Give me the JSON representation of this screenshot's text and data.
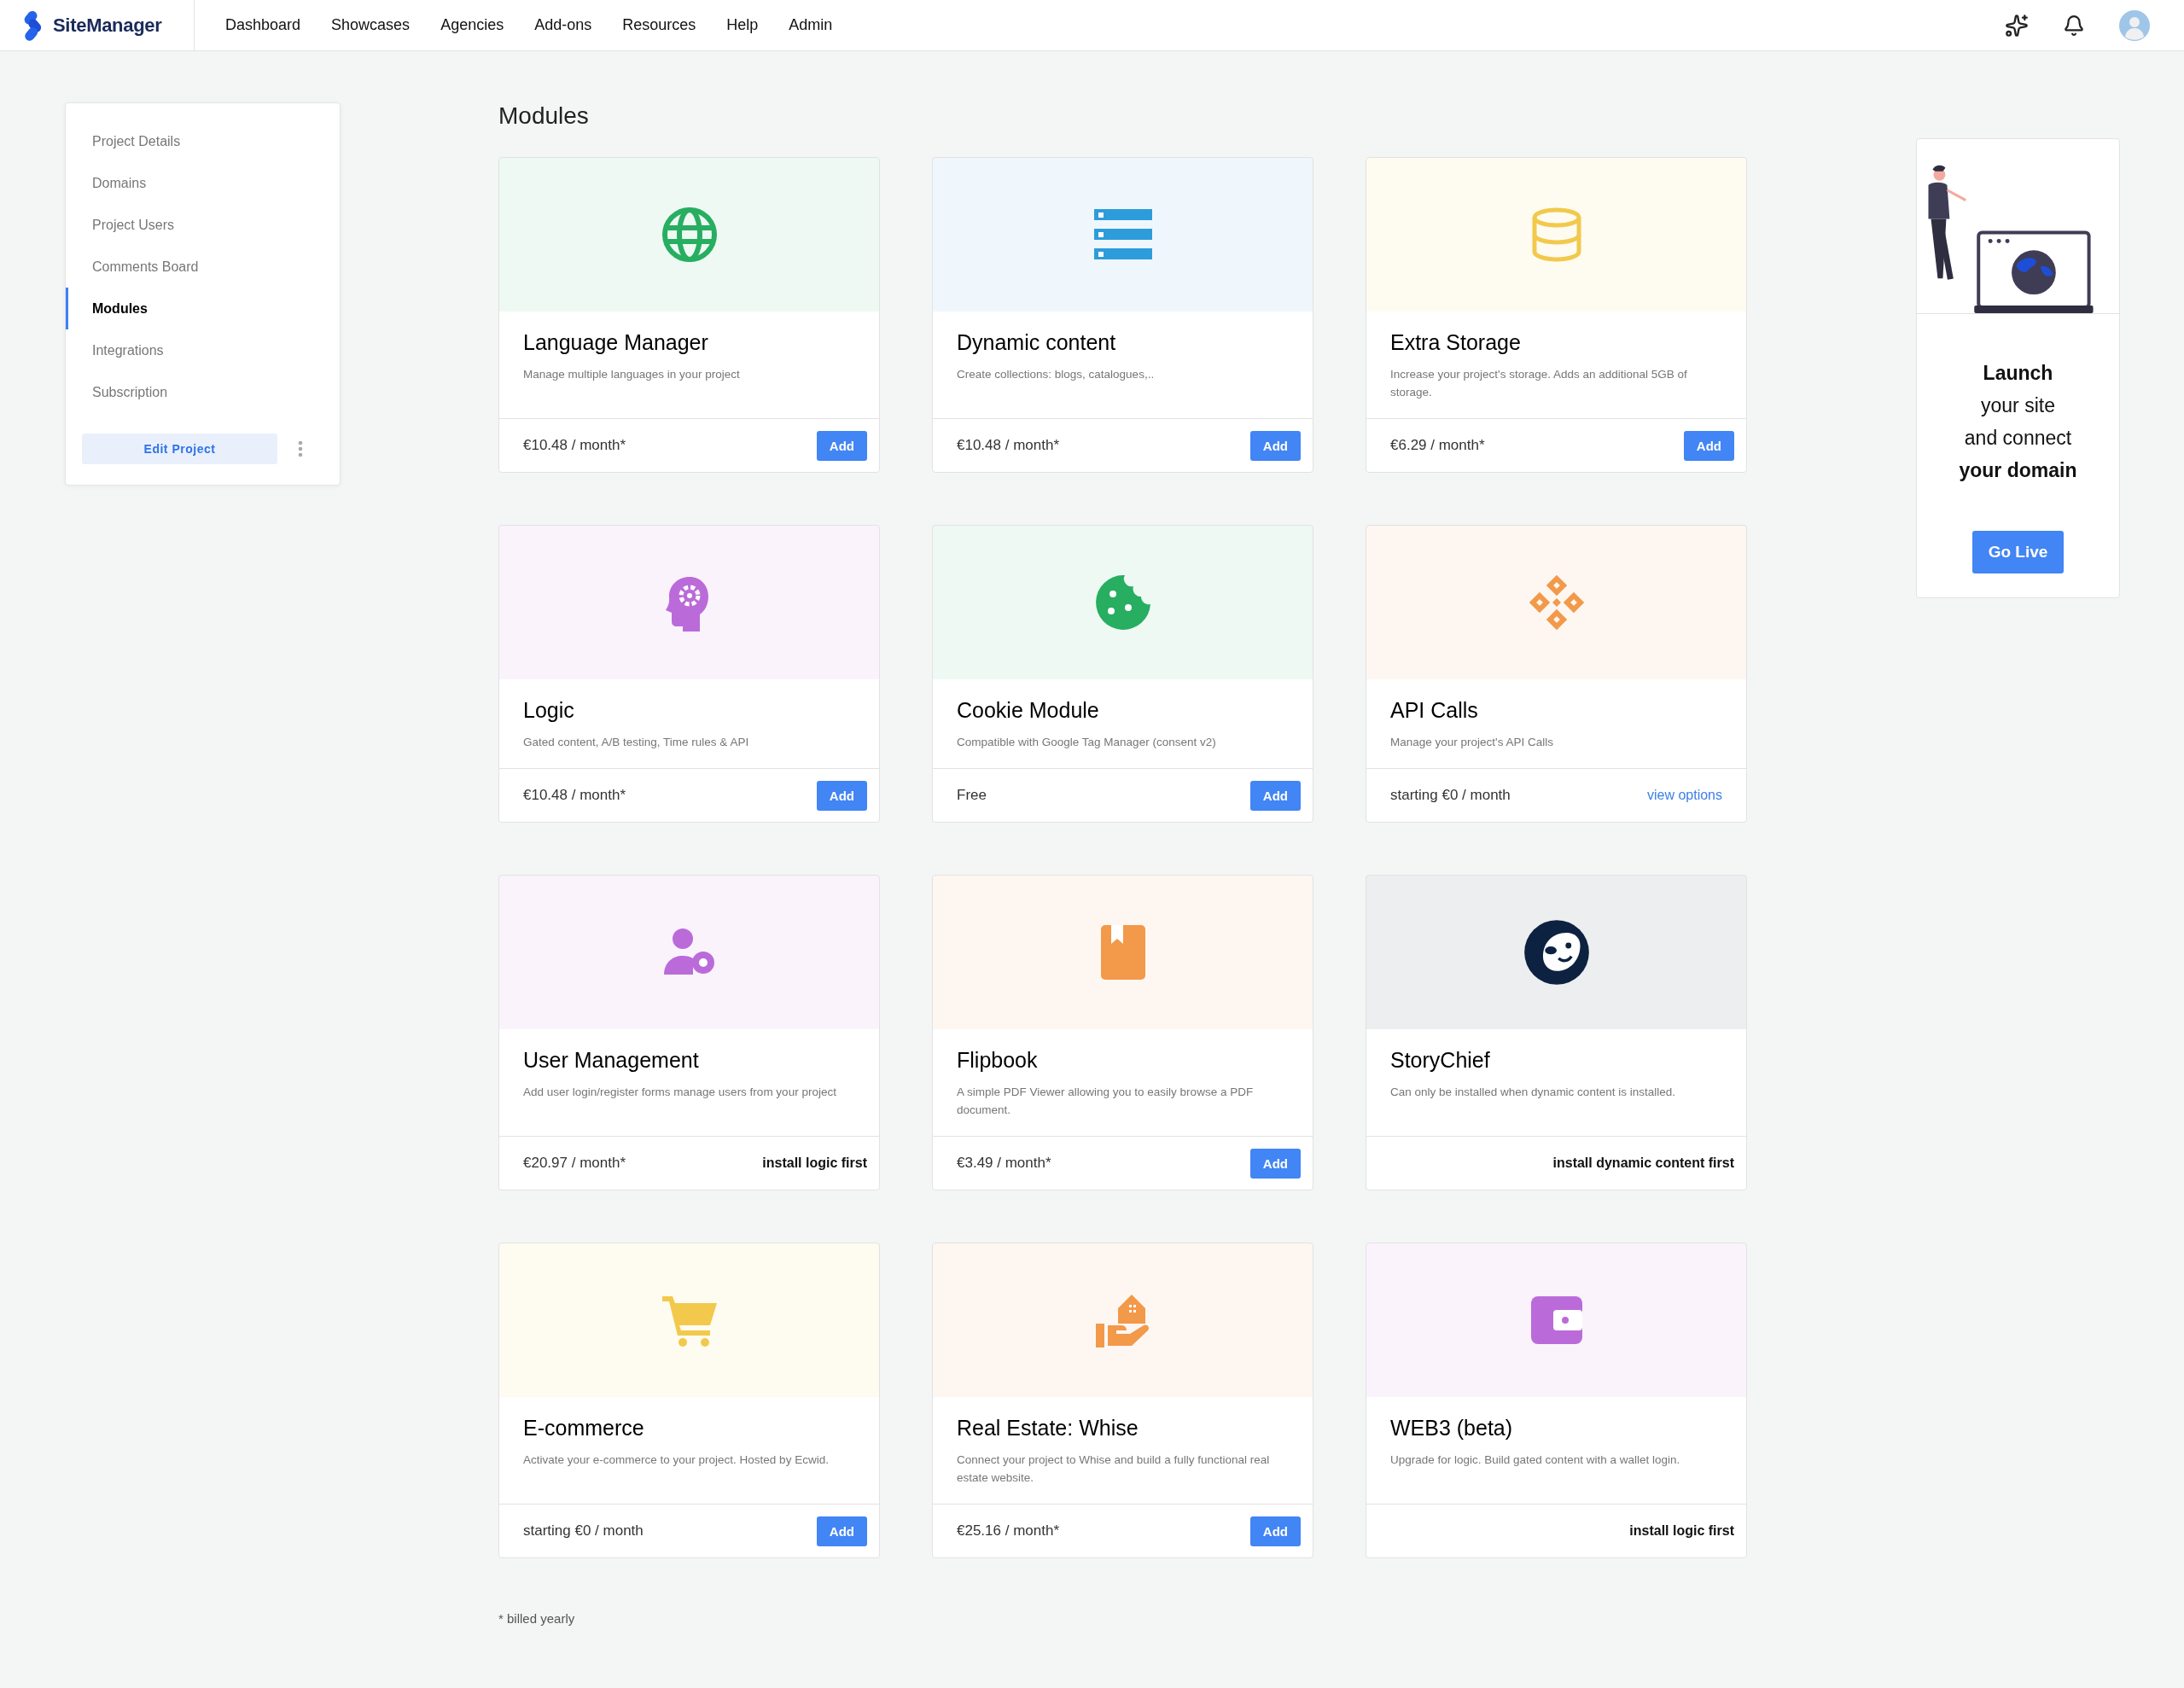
{
  "header": {
    "brand": "SiteManager",
    "nav": [
      {
        "label": "Dashboard"
      },
      {
        "label": "Showcases"
      },
      {
        "label": "Agencies"
      },
      {
        "label": "Add-ons"
      },
      {
        "label": "Resources"
      },
      {
        "label": "Help"
      },
      {
        "label": "Admin"
      }
    ]
  },
  "sidebar": {
    "items": [
      {
        "label": "Project Details",
        "selected": false
      },
      {
        "label": "Domains",
        "selected": false
      },
      {
        "label": "Project Users",
        "selected": false
      },
      {
        "label": "Comments Board",
        "selected": false
      },
      {
        "label": "Modules",
        "selected": true
      },
      {
        "label": "Integrations",
        "selected": false
      },
      {
        "label": "Subscription",
        "selected": false
      }
    ],
    "button": "Edit Project"
  },
  "page_title": "Modules",
  "modules": [
    {
      "title": "Language Manager",
      "description": "Manage multiple languages in your project",
      "color": "#27ae60",
      "price": "€10.48 / month*",
      "action": {
        "kind": "button",
        "label": "Add"
      }
    },
    {
      "title": "Dynamic content",
      "description": "Create collections: blogs, catalogues,..",
      "color": "#2d9cdb",
      "price": "€10.48 / month*",
      "action": {
        "kind": "button",
        "label": "Add"
      }
    },
    {
      "title": "Extra Storage",
      "description": "Increase your project's storage. Adds an additional 5GB of storage.",
      "color": "#f2c94c",
      "price": "€6.29 / month*",
      "action": {
        "kind": "button",
        "label": "Add"
      }
    },
    {
      "title": "Logic",
      "description": "Gated content, A/B testing, Time rules & API",
      "color": "#bb6bd9",
      "price": "€10.48 / month*",
      "action": {
        "kind": "button",
        "label": "Add"
      }
    },
    {
      "title": "Cookie Module",
      "description": "Compatible with Google Tag Manager (consent v2)",
      "color": "#27ae60",
      "price": "Free",
      "action": {
        "kind": "button",
        "label": "Add"
      }
    },
    {
      "title": "API Calls",
      "description": "Manage your project's API Calls",
      "color": "#f2994a",
      "price": "starting €0 / month",
      "action": {
        "kind": "link",
        "label": "view options"
      }
    },
    {
      "title": "User Management",
      "description": "Add user login/register forms manage users from your project",
      "color": "#bb6bd9",
      "price": "€20.97 / month*",
      "action": {
        "kind": "note",
        "label": "install logic first"
      }
    },
    {
      "title": "Flipbook",
      "description": "A simple PDF Viewer allowing you to easily browse a PDF document.",
      "color": "#f2994a",
      "price": "€3.49 / month*",
      "action": {
        "kind": "button",
        "label": "Add"
      }
    },
    {
      "title": "StoryChief",
      "description": "Can only be installed when dynamic content is installed.",
      "color": "#0d2240",
      "action": {
        "kind": "note",
        "label": "install dynamic content first"
      }
    },
    {
      "title": "E-commerce",
      "description": "Activate your e-commerce to your project. Hosted by Ecwid.",
      "color": "#f2c94c",
      "price": "starting €0 / month",
      "action": {
        "kind": "button",
        "label": "Add"
      }
    },
    {
      "title": "Real Estate: Whise",
      "description": "Connect your project to Whise and build a fully functional real estate website.",
      "color": "#f2994a",
      "price": "€25.16 / month*",
      "action": {
        "kind": "button",
        "label": "Add"
      }
    },
    {
      "title": "WEB3 (beta)",
      "description": "Upgrade for logic. Build gated content with a wallet login.",
      "color": "#bb6bd9",
      "action": {
        "kind": "note",
        "label": "install logic first"
      }
    }
  ],
  "footnote": "* billed yearly",
  "promo": {
    "text": "**Launch**\nyour site\nand connect\n**your domain**",
    "button": "Go Live"
  }
}
